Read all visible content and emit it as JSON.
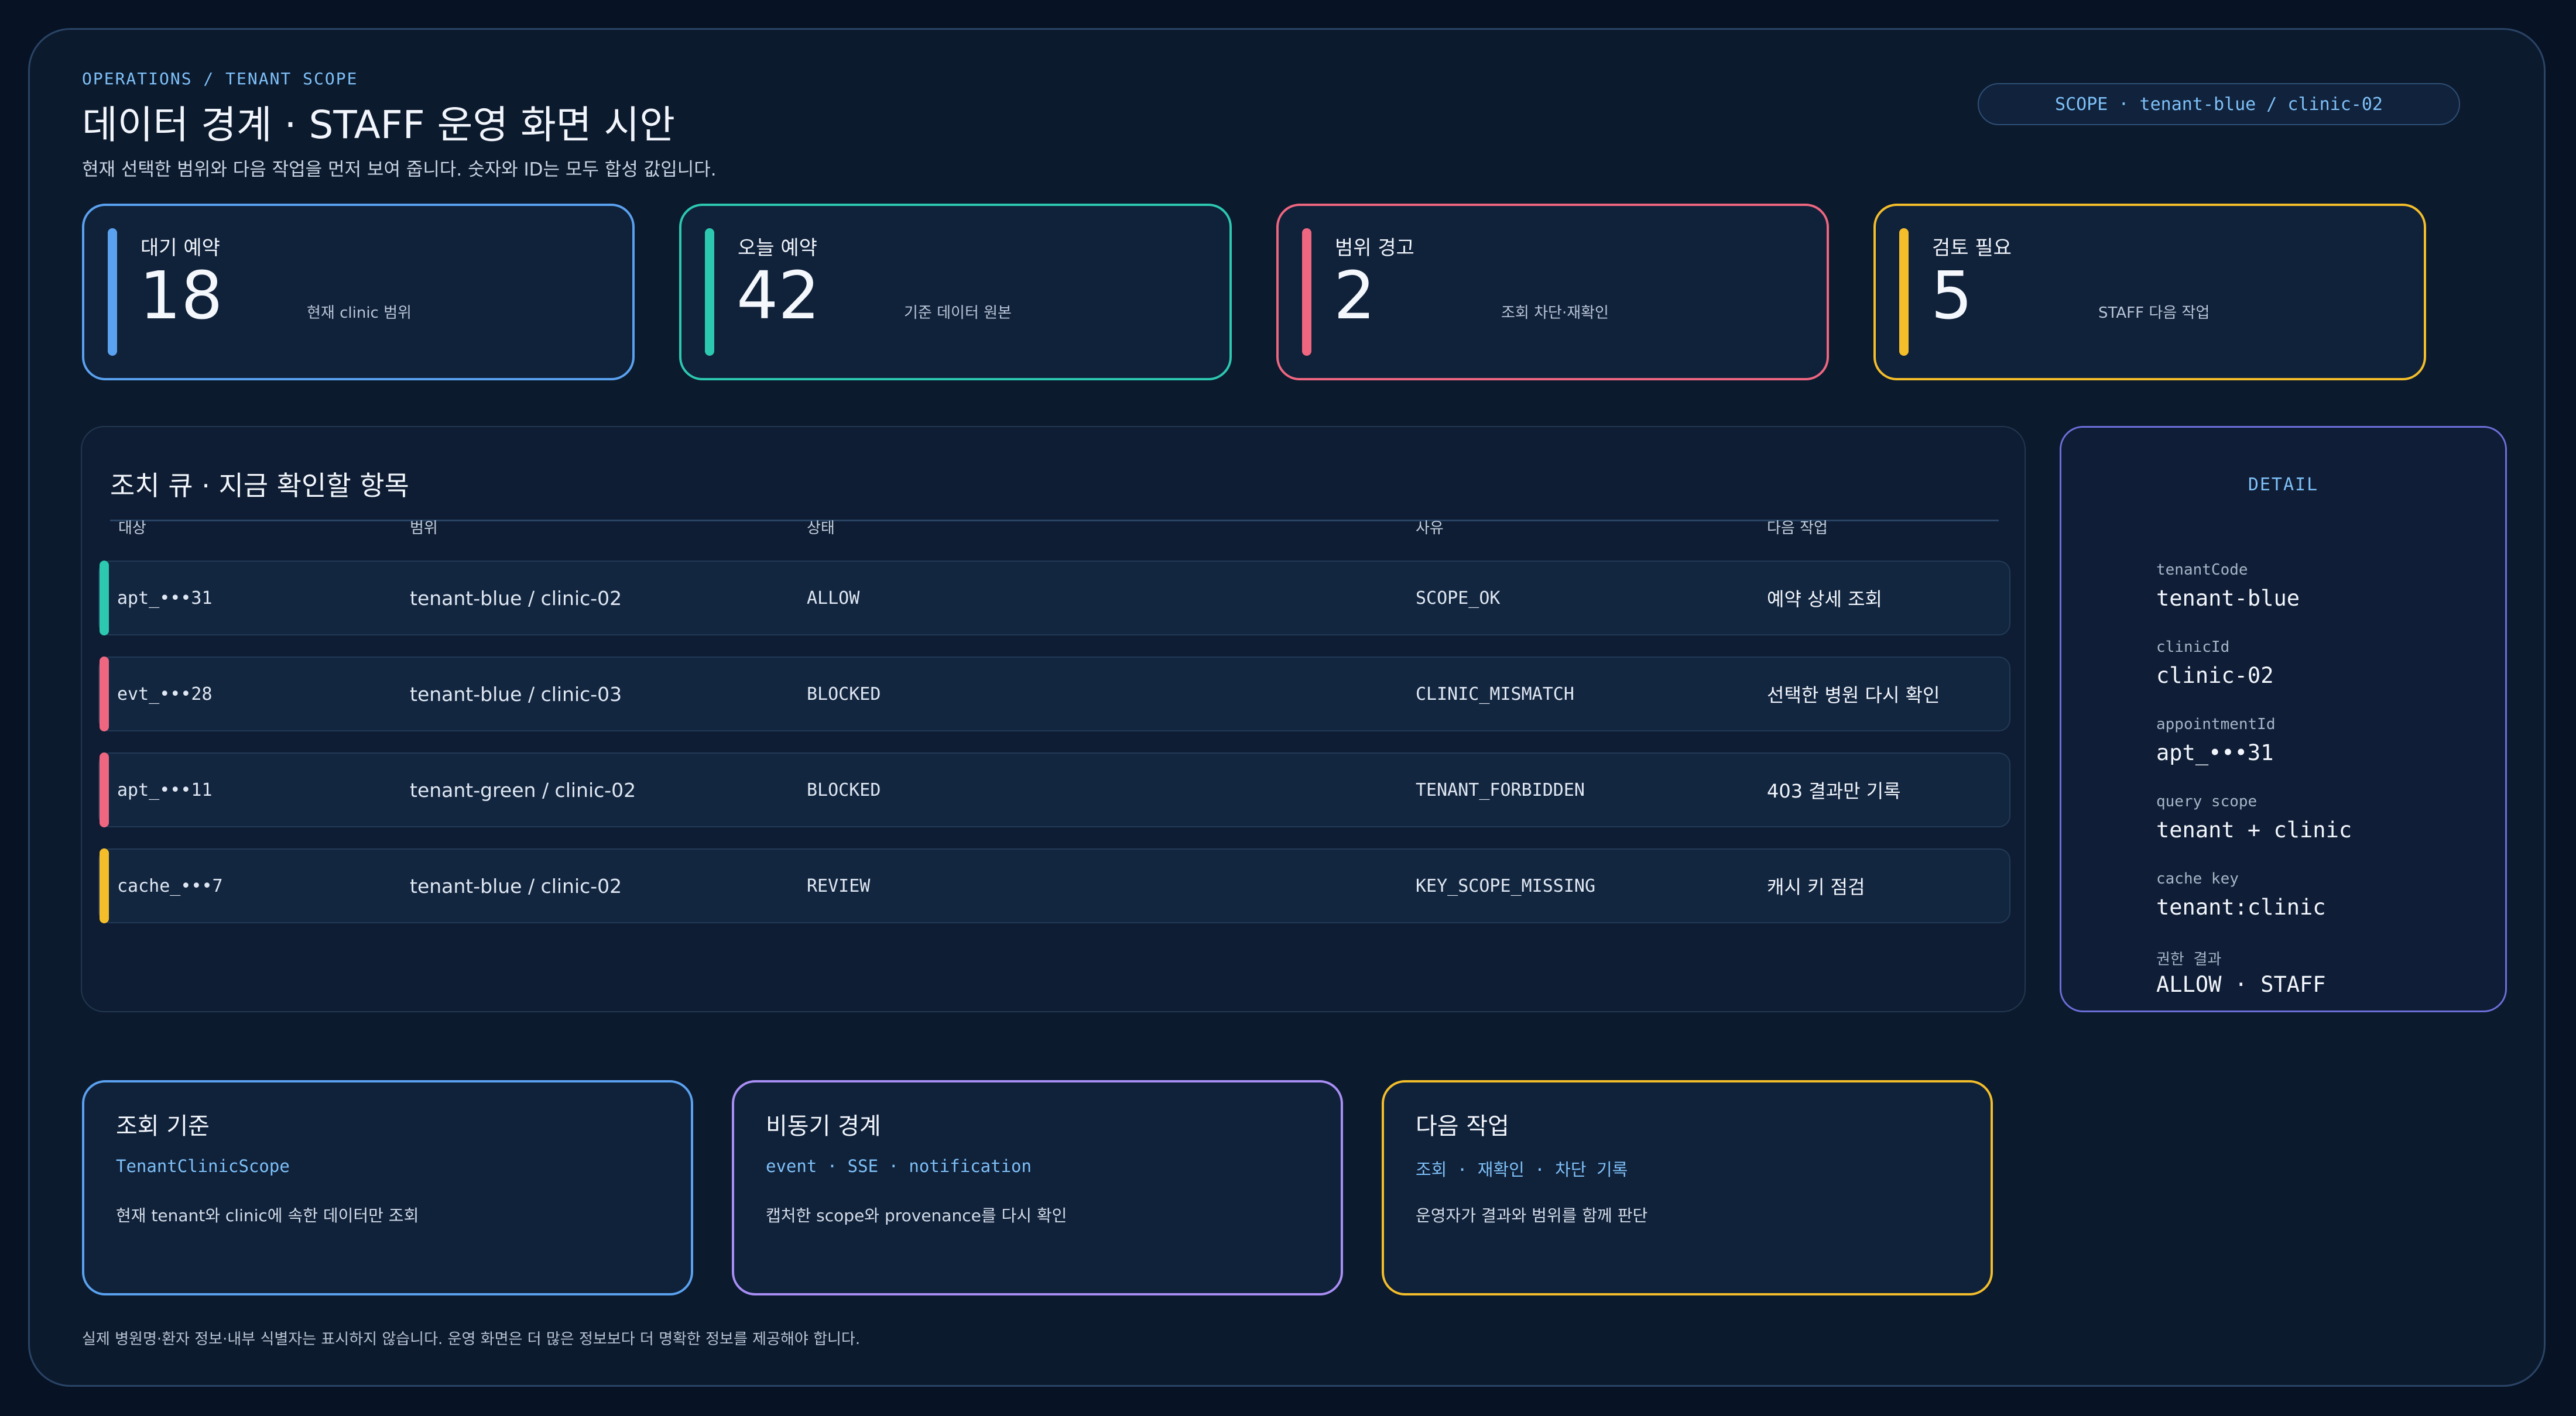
{
  "header": {
    "breadcrumb": "OPERATIONS / TENANT SCOPE",
    "title": "데이터 경계 · STAFF 운영 화면 시안",
    "subtitle": "현재 선택한 범위와 다음 작업을 먼저 보여 줍니다. 숫자와 ID는 모두 합성 값입니다.",
    "scope_pill": "SCOPE · tenant-blue / clinic-02"
  },
  "stats": [
    {
      "label": "대기 예약",
      "value": "18",
      "note": "현재 clinic 범위",
      "color": "#5aa2f0"
    },
    {
      "label": "오늘 예약",
      "value": "42",
      "note": "기준 데이터 원본",
      "color": "#2cc8b0"
    },
    {
      "label": "범위 경고",
      "value": "2",
      "note": "조회 차단·재확인",
      "color": "#ef6680"
    },
    {
      "label": "검토 필요",
      "value": "5",
      "note": "STAFF 다음 작업",
      "color": "#f4be2a"
    }
  ],
  "queue": {
    "title": "조치 큐 · 지금 확인할 항목",
    "columns": [
      "대상",
      "범위",
      "상태",
      "사유",
      "다음 작업"
    ],
    "rows": [
      {
        "target": "apt_•••31",
        "scope": "tenant-blue / clinic-02",
        "status": "ALLOW",
        "reason": "SCOPE_OK",
        "next": "예약 상세 조회",
        "color": "#2cc8b0"
      },
      {
        "target": "evt_•••28",
        "scope": "tenant-blue / clinic-03",
        "status": "BLOCKED",
        "reason": "CLINIC_MISMATCH",
        "next": "선택한 병원 다시 확인",
        "color": "#ef6680"
      },
      {
        "target": "apt_•••11",
        "scope": "tenant-green / clinic-02",
        "status": "BLOCKED",
        "reason": "TENANT_FORBIDDEN",
        "next": "403 결과만 기록",
        "color": "#ef6680"
      },
      {
        "target": "cache_•••7",
        "scope": "tenant-blue / clinic-02",
        "status": "REVIEW",
        "reason": "KEY_SCOPE_MISSING",
        "next": "캐시 키 점검",
        "color": "#f4be2a"
      }
    ]
  },
  "detail": {
    "title": "DETAIL",
    "fields": [
      {
        "key": "tenantCode",
        "value": "tenant-blue"
      },
      {
        "key": "clinicId",
        "value": "clinic-02"
      },
      {
        "key": "appointmentId",
        "value": "apt_•••31"
      },
      {
        "key": "query scope",
        "value": "tenant + clinic"
      },
      {
        "key": "cache key",
        "value": "tenant:clinic"
      },
      {
        "key": "권한 결과",
        "value": "ALLOW · STAFF"
      }
    ]
  },
  "cards": [
    {
      "title": "조회 기준",
      "tag": "TenantClinicScope",
      "desc": "현재 tenant와 clinic에 속한 데이터만 조회",
      "color": "#5aa2f0"
    },
    {
      "title": "비동기 경계",
      "tag": "event · SSE · notification",
      "desc": "캡처한 scope와 provenance를 다시 확인",
      "color": "#a98ef5"
    },
    {
      "title": "다음 작업",
      "tag": "조회 · 재확인 · 차단 기록",
      "desc": "운영자가 결과와 범위를 함께 판단",
      "color": "#f4be2a"
    }
  ],
  "footer": "실제 병원명·환자 정보·내부 식별자는 표시하지 않습니다. 운영 화면은 더 많은 정보보다 더 명확한 정보를 제공해야 합니다."
}
